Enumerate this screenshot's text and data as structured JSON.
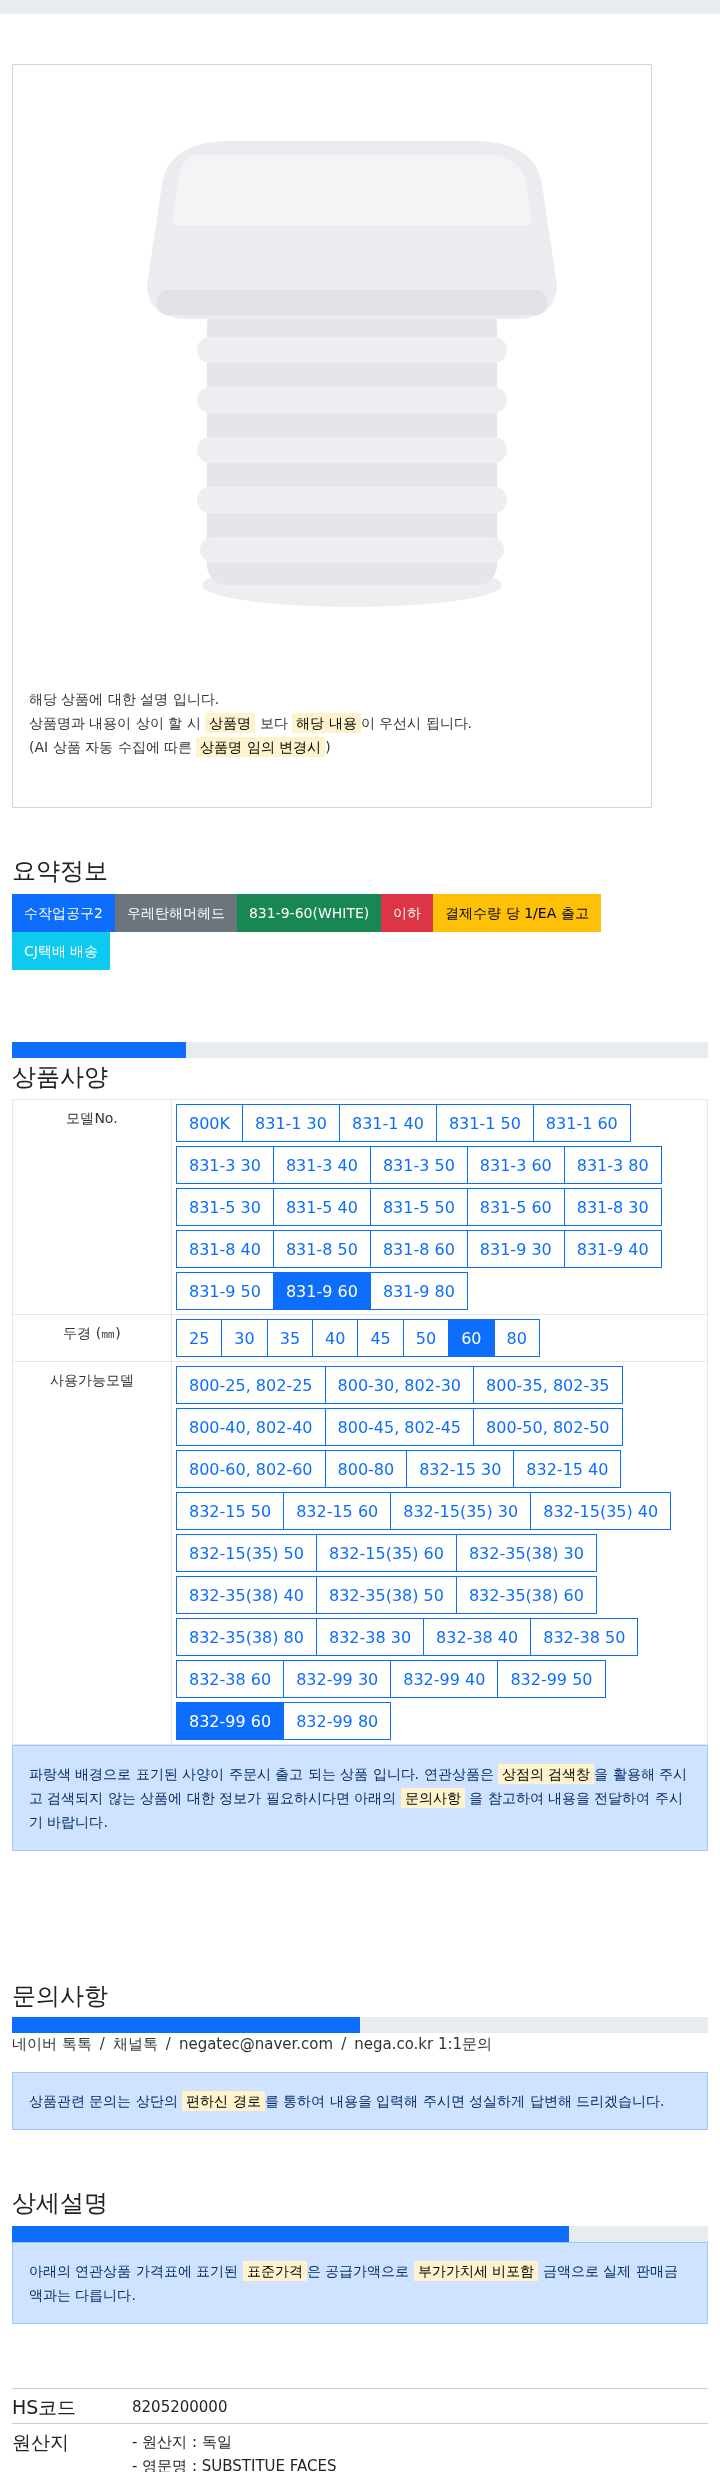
{
  "product_card": {
    "description": [
      [
        {
          "text": "해당 상품에 대한 설명 입니다.",
          "highlight": false
        }
      ],
      [
        {
          "text": "상품명과 내용이 상이 할 시 ",
          "highlight": false
        },
        {
          "text": "상품명",
          "highlight": true
        },
        {
          "text": " 보다 ",
          "highlight": false
        },
        {
          "text": "해당 내용",
          "highlight": true
        },
        {
          "text": "이 우선시 됩니다.",
          "highlight": false
        }
      ],
      [
        {
          "text": "(AI 상품 자동 수집에 따른 ",
          "highlight": false
        },
        {
          "text": "상품명 임의 변경시",
          "highlight": true
        },
        {
          "text": ")",
          "highlight": false
        }
      ]
    ]
  },
  "summary": {
    "title": "요약정보",
    "tags": [
      {
        "text": "수작업공구2",
        "color": "#0d6efd"
      },
      {
        "text": "우레탄해머헤드",
        "color": "#6c757d"
      },
      {
        "text": "831-9-60(WHITE)",
        "color": "#198754"
      },
      {
        "text": "이하",
        "color": "#dc3545"
      },
      {
        "text": "결제수량 당 1/EA 출고",
        "color": "#ffc107"
      },
      {
        "text": "CJ택배 배송",
        "color": "#0dcaf0"
      }
    ]
  },
  "spec": {
    "level": 0.25,
    "title": "상품사양",
    "rows": [
      {
        "label": "모델No.",
        "options": [
          {
            "label": "800K",
            "selected": false
          },
          {
            "label": "831-1 30",
            "selected": false
          },
          {
            "label": "831-1 40",
            "selected": false
          },
          {
            "label": "831-1 50",
            "selected": false
          },
          {
            "label": "831-1 60",
            "selected": false
          },
          {
            "label": "831-3 30",
            "selected": false
          },
          {
            "label": "831-3 40",
            "selected": false
          },
          {
            "label": "831-3 50",
            "selected": false
          },
          {
            "label": "831-3 60",
            "selected": false
          },
          {
            "label": "831-3 80",
            "selected": false
          },
          {
            "label": "831-5 30",
            "selected": false
          },
          {
            "label": "831-5 40",
            "selected": false
          },
          {
            "label": "831-5 50",
            "selected": false
          },
          {
            "label": "831-5 60",
            "selected": false
          },
          {
            "label": "831-8 30",
            "selected": false
          },
          {
            "label": "831-8 40",
            "selected": false
          },
          {
            "label": "831-8 50",
            "selected": false
          },
          {
            "label": "831-8 60",
            "selected": false
          },
          {
            "label": "831-9 30",
            "selected": false
          },
          {
            "label": "831-9 40",
            "selected": false
          },
          {
            "label": "831-9 50",
            "selected": false
          },
          {
            "label": "831-9 60",
            "selected": true
          },
          {
            "label": "831-9 80",
            "selected": false
          }
        ]
      },
      {
        "label": "두경 (㎜)",
        "options": [
          {
            "label": "25",
            "selected": false
          },
          {
            "label": "30",
            "selected": false
          },
          {
            "label": "35",
            "selected": false
          },
          {
            "label": "40",
            "selected": false
          },
          {
            "label": "45",
            "selected": false
          },
          {
            "label": "50",
            "selected": false
          },
          {
            "label": "60",
            "selected": true
          },
          {
            "label": "80",
            "selected": false
          }
        ]
      },
      {
        "label": "사용가능모델",
        "options": [
          {
            "label": "800-25, 802-25",
            "selected": false
          },
          {
            "label": "800-30, 802-30",
            "selected": false
          },
          {
            "label": "800-35, 802-35",
            "selected": false
          },
          {
            "label": "800-40, 802-40",
            "selected": false
          },
          {
            "label": "800-45, 802-45",
            "selected": false
          },
          {
            "label": "800-50, 802-50",
            "selected": false
          },
          {
            "label": "800-60, 802-60",
            "selected": false
          },
          {
            "label": "800-80",
            "selected": false
          },
          {
            "label": "832-15 30",
            "selected": false
          },
          {
            "label": "832-15 40",
            "selected": false
          },
          {
            "label": "832-15 50",
            "selected": false
          },
          {
            "label": "832-15 60",
            "selected": false
          },
          {
            "label": "832-15(35) 30",
            "selected": false
          },
          {
            "label": "832-15(35) 40",
            "selected": false
          },
          {
            "label": "832-15(35) 50",
            "selected": false
          },
          {
            "label": "832-15(35) 60",
            "selected": false
          },
          {
            "label": "832-35(38) 30",
            "selected": false
          },
          {
            "label": "832-35(38) 40",
            "selected": false
          },
          {
            "label": "832-35(38) 50",
            "selected": false
          },
          {
            "label": "832-35(38) 60",
            "selected": false
          },
          {
            "label": "832-35(38) 80",
            "selected": false
          },
          {
            "label": "832-38 30",
            "selected": false
          },
          {
            "label": "832-38 40",
            "selected": false
          },
          {
            "label": "832-38 50",
            "selected": false
          },
          {
            "label": "832-38 60",
            "selected": false
          },
          {
            "label": "832-99 30",
            "selected": false
          },
          {
            "label": "832-99 40",
            "selected": false
          },
          {
            "label": "832-99 50",
            "selected": false
          },
          {
            "label": "832-99 60",
            "selected": true
          },
          {
            "label": "832-99 80",
            "selected": false
          }
        ]
      }
    ],
    "notice": [
      {
        "text": "파랑색 배경으로 표기된 사양이 주문시 출고 되는 상품 입니다. 연관상품은 ",
        "highlight": false
      },
      {
        "text": "상점의 검색창",
        "highlight": true
      },
      {
        "text": "을 활용해 주시고 검색되지 않는 상품에 대한 정보가 필요하시다면 아래의 ",
        "highlight": false
      },
      {
        "text": "문의사항",
        "highlight": true
      },
      {
        "text": " 을 참고하여 내용을 전달하여 주시기 바랍니다.",
        "highlight": false
      }
    ]
  },
  "inquiry": {
    "title": "문의사항",
    "level": 0.5,
    "separator": "/",
    "channels": [
      "네이버 톡톡",
      "채널톡",
      "negatec@naver.com",
      "nega.co.kr 1:1문의"
    ],
    "notice": [
      {
        "text": "상품관련 문의는 상단의 ",
        "highlight": false
      },
      {
        "text": "편하신 경로",
        "highlight": true
      },
      {
        "text": "를 통하여 내용을 입력해 주시면 성실하게 답변해 드리겠습니다.",
        "highlight": false
      }
    ]
  },
  "details": {
    "title": "상세설명",
    "level": 0.8,
    "notice": [
      {
        "text": "아래의 연관상품 가격표에 표기된 ",
        "highlight": false
      },
      {
        "text": "표준가격",
        "highlight": true
      },
      {
        "text": "은 공급가액으로 ",
        "highlight": false
      },
      {
        "text": "부가가치세 비포함",
        "highlight": true
      },
      {
        "text": " 금액으로 실제 판매금액과는 다릅니다.",
        "highlight": false
      }
    ],
    "info": [
      {
        "label": "HS코드",
        "lines": [
          "8205200000"
        ]
      },
      {
        "label": "원산지",
        "lines": [
          "- 원산지 : 독일",
          "- 영문명 : SUBSTITUE FACES"
        ]
      }
    ]
  }
}
